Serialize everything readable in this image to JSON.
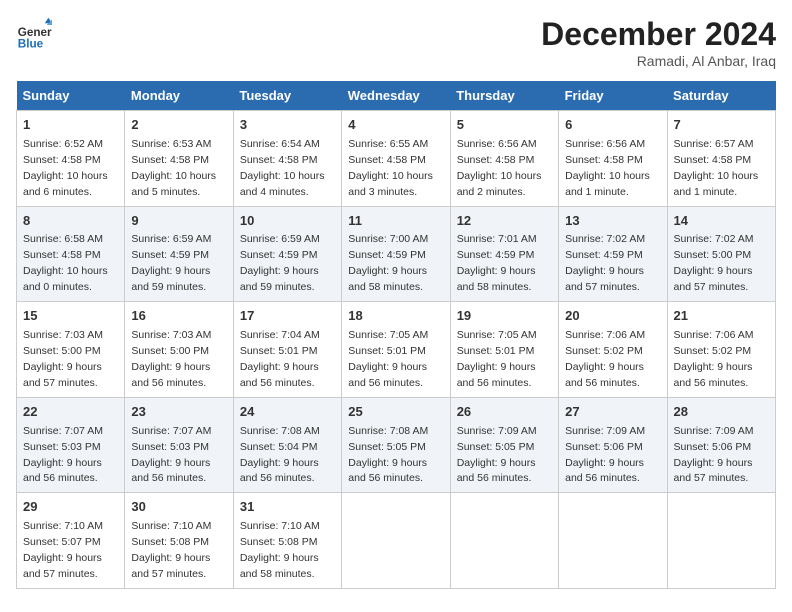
{
  "header": {
    "logo_line1": "General",
    "logo_line2": "Blue",
    "month": "December 2024",
    "location": "Ramadi, Al Anbar, Iraq"
  },
  "weekdays": [
    "Sunday",
    "Monday",
    "Tuesday",
    "Wednesday",
    "Thursday",
    "Friday",
    "Saturday"
  ],
  "weeks": [
    [
      {
        "day": "1",
        "info": "Sunrise: 6:52 AM\nSunset: 4:58 PM\nDaylight: 10 hours and 6 minutes."
      },
      {
        "day": "2",
        "info": "Sunrise: 6:53 AM\nSunset: 4:58 PM\nDaylight: 10 hours and 5 minutes."
      },
      {
        "day": "3",
        "info": "Sunrise: 6:54 AM\nSunset: 4:58 PM\nDaylight: 10 hours and 4 minutes."
      },
      {
        "day": "4",
        "info": "Sunrise: 6:55 AM\nSunset: 4:58 PM\nDaylight: 10 hours and 3 minutes."
      },
      {
        "day": "5",
        "info": "Sunrise: 6:56 AM\nSunset: 4:58 PM\nDaylight: 10 hours and 2 minutes."
      },
      {
        "day": "6",
        "info": "Sunrise: 6:56 AM\nSunset: 4:58 PM\nDaylight: 10 hours and 1 minute."
      },
      {
        "day": "7",
        "info": "Sunrise: 6:57 AM\nSunset: 4:58 PM\nDaylight: 10 hours and 1 minute."
      }
    ],
    [
      {
        "day": "8",
        "info": "Sunrise: 6:58 AM\nSunset: 4:58 PM\nDaylight: 10 hours and 0 minutes."
      },
      {
        "day": "9",
        "info": "Sunrise: 6:59 AM\nSunset: 4:59 PM\nDaylight: 9 hours and 59 minutes."
      },
      {
        "day": "10",
        "info": "Sunrise: 6:59 AM\nSunset: 4:59 PM\nDaylight: 9 hours and 59 minutes."
      },
      {
        "day": "11",
        "info": "Sunrise: 7:00 AM\nSunset: 4:59 PM\nDaylight: 9 hours and 58 minutes."
      },
      {
        "day": "12",
        "info": "Sunrise: 7:01 AM\nSunset: 4:59 PM\nDaylight: 9 hours and 58 minutes."
      },
      {
        "day": "13",
        "info": "Sunrise: 7:02 AM\nSunset: 4:59 PM\nDaylight: 9 hours and 57 minutes."
      },
      {
        "day": "14",
        "info": "Sunrise: 7:02 AM\nSunset: 5:00 PM\nDaylight: 9 hours and 57 minutes."
      }
    ],
    [
      {
        "day": "15",
        "info": "Sunrise: 7:03 AM\nSunset: 5:00 PM\nDaylight: 9 hours and 57 minutes."
      },
      {
        "day": "16",
        "info": "Sunrise: 7:03 AM\nSunset: 5:00 PM\nDaylight: 9 hours and 56 minutes."
      },
      {
        "day": "17",
        "info": "Sunrise: 7:04 AM\nSunset: 5:01 PM\nDaylight: 9 hours and 56 minutes."
      },
      {
        "day": "18",
        "info": "Sunrise: 7:05 AM\nSunset: 5:01 PM\nDaylight: 9 hours and 56 minutes."
      },
      {
        "day": "19",
        "info": "Sunrise: 7:05 AM\nSunset: 5:01 PM\nDaylight: 9 hours and 56 minutes."
      },
      {
        "day": "20",
        "info": "Sunrise: 7:06 AM\nSunset: 5:02 PM\nDaylight: 9 hours and 56 minutes."
      },
      {
        "day": "21",
        "info": "Sunrise: 7:06 AM\nSunset: 5:02 PM\nDaylight: 9 hours and 56 minutes."
      }
    ],
    [
      {
        "day": "22",
        "info": "Sunrise: 7:07 AM\nSunset: 5:03 PM\nDaylight: 9 hours and 56 minutes."
      },
      {
        "day": "23",
        "info": "Sunrise: 7:07 AM\nSunset: 5:03 PM\nDaylight: 9 hours and 56 minutes."
      },
      {
        "day": "24",
        "info": "Sunrise: 7:08 AM\nSunset: 5:04 PM\nDaylight: 9 hours and 56 minutes."
      },
      {
        "day": "25",
        "info": "Sunrise: 7:08 AM\nSunset: 5:05 PM\nDaylight: 9 hours and 56 minutes."
      },
      {
        "day": "26",
        "info": "Sunrise: 7:09 AM\nSunset: 5:05 PM\nDaylight: 9 hours and 56 minutes."
      },
      {
        "day": "27",
        "info": "Sunrise: 7:09 AM\nSunset: 5:06 PM\nDaylight: 9 hours and 56 minutes."
      },
      {
        "day": "28",
        "info": "Sunrise: 7:09 AM\nSunset: 5:06 PM\nDaylight: 9 hours and 57 minutes."
      }
    ],
    [
      {
        "day": "29",
        "info": "Sunrise: 7:10 AM\nSunset: 5:07 PM\nDaylight: 9 hours and 57 minutes."
      },
      {
        "day": "30",
        "info": "Sunrise: 7:10 AM\nSunset: 5:08 PM\nDaylight: 9 hours and 57 minutes."
      },
      {
        "day": "31",
        "info": "Sunrise: 7:10 AM\nSunset: 5:08 PM\nDaylight: 9 hours and 58 minutes."
      },
      null,
      null,
      null,
      null
    ]
  ]
}
